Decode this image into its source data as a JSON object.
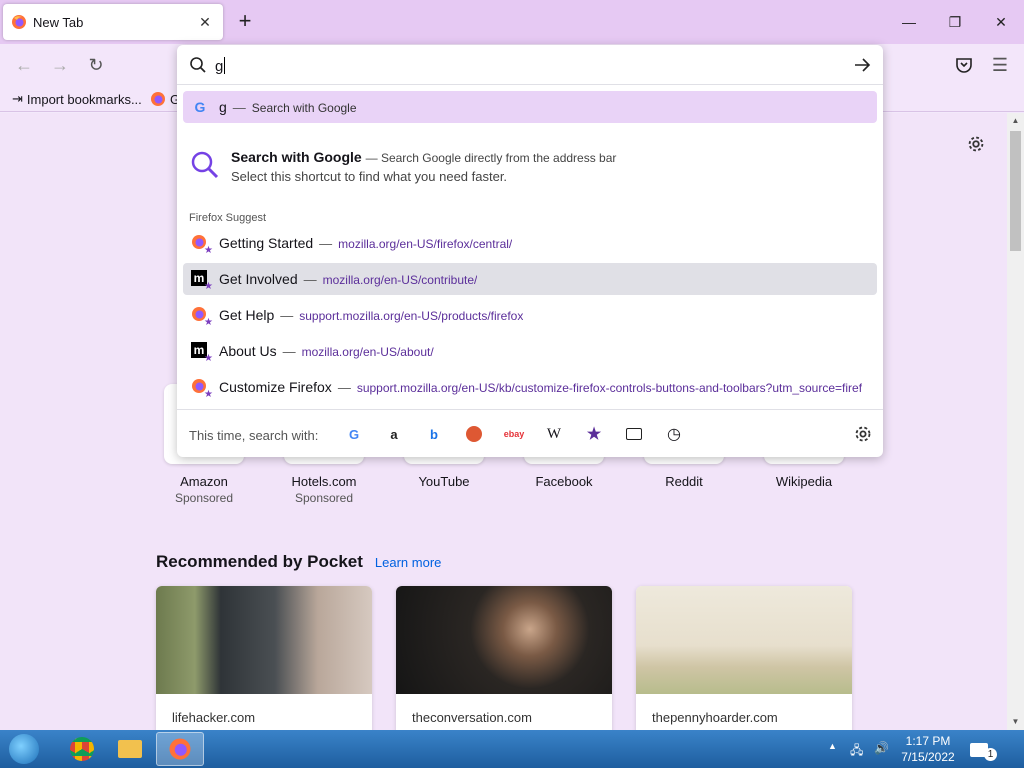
{
  "browser": {
    "tab": {
      "title": "New Tab"
    },
    "bookmarks": [
      {
        "label": "Import bookmarks..."
      },
      {
        "label": "G"
      }
    ],
    "url_bar": {
      "typed": "g"
    }
  },
  "dropdown": {
    "top_result": {
      "text": "g",
      "action": "Search with Google"
    },
    "tip": {
      "title": "Search with Google",
      "subtitle": "Search Google directly from the address bar",
      "description": "Select this shortcut to find what you need faster."
    },
    "group_label": "Firefox Suggest",
    "suggestions": [
      {
        "title": "Getting Started",
        "url": "mozilla.org/en-US/firefox/central/",
        "icon": "firefox-icon"
      },
      {
        "title": "Get Involved",
        "url": "mozilla.org/en-US/contribute/",
        "icon": "mozilla-m-icon"
      },
      {
        "title": "Get Help",
        "url": "support.mozilla.org/en-US/products/firefox",
        "icon": "firefox-icon"
      },
      {
        "title": "About Us",
        "url": "mozilla.org/en-US/about/",
        "icon": "mozilla-m-icon"
      },
      {
        "title": "Customize Firefox",
        "url": "support.mozilla.org/en-US/kb/customize-firefox-controls-buttons-and-toolbars?utm_source=firef",
        "icon": "firefox-icon"
      }
    ],
    "oneoff_label": "This time, search with:",
    "engines": [
      "google",
      "amazon",
      "bing",
      "duckduckgo",
      "ebay",
      "wikipedia",
      "bookmarks",
      "tabs",
      "history"
    ]
  },
  "top_sites": [
    {
      "name": "Amazon",
      "sponsored": "Sponsored"
    },
    {
      "name": "Hotels.com",
      "sponsored": "Sponsored"
    },
    {
      "name": "YouTube",
      "sponsored": ""
    },
    {
      "name": "Facebook",
      "sponsored": ""
    },
    {
      "name": "Reddit",
      "sponsored": ""
    },
    {
      "name": "Wikipedia",
      "sponsored": ""
    }
  ],
  "pocket": {
    "title": "Recommended by Pocket",
    "learn_more": "Learn more",
    "cards": [
      {
        "source": "lifehacker.com"
      },
      {
        "source": "theconversation.com"
      },
      {
        "source": "thepennyhoarder.com"
      }
    ]
  },
  "taskbar": {
    "time": "1:17 PM",
    "date": "7/15/2022",
    "notifications": "1"
  },
  "colors": {
    "accent": "#7542e5",
    "tabstrip": "#e6c9f3",
    "selection": "#e9d3f7",
    "link": "#0061e0"
  }
}
